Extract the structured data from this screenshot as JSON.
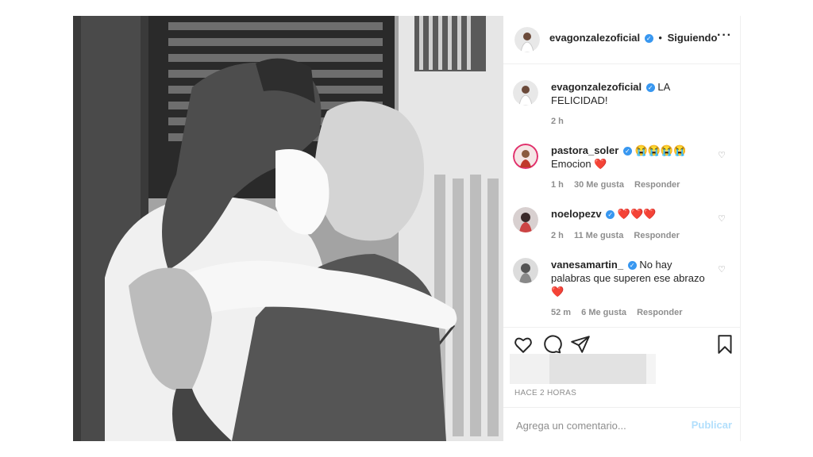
{
  "post": {
    "author": "evagonzalezoficial",
    "following_label": "Siguiendo",
    "separator": "•",
    "more_icon": "···",
    "caption": "LA FELICIDAD!",
    "caption_time": "2 h"
  },
  "comments": [
    {
      "user": "pastora_soler",
      "text": "😭😭😭😭 Emocion ❤️",
      "time": "1 h",
      "likes": "30 Me gusta",
      "reply": "Responder"
    },
    {
      "user": "noelopezv",
      "text": "❤️❤️❤️",
      "time": "2 h",
      "likes": "11 Me gusta",
      "reply": "Responder"
    },
    {
      "user": "vanesamartin_",
      "text": "No hay palabras que superen ese abrazo ❤️",
      "time": "52 m",
      "likes": "6 Me gusta",
      "reply": "Responder"
    }
  ],
  "actions": {
    "like_icon": "heart-icon",
    "comment_icon": "comment-icon",
    "share_icon": "paper-plane-icon",
    "save_icon": "bookmark-icon"
  },
  "timestamp": "HACE 2 HORAS",
  "composer": {
    "placeholder": "Agrega un comentario...",
    "publish_label": "Publicar"
  },
  "colors": {
    "verified": "#3897f0",
    "publish_disabled": "#b2dffc",
    "secondary_text": "#8e8e8e"
  }
}
